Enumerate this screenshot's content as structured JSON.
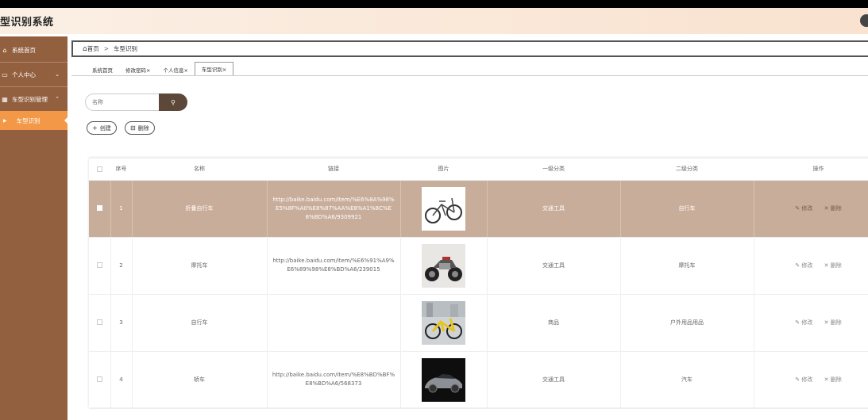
{
  "header": {
    "title": "型识别系统"
  },
  "sidebar": {
    "items": [
      {
        "label": "系统首页",
        "icon": "home-icon"
      },
      {
        "label": "个人中心",
        "icon": "user-card-icon"
      },
      {
        "label": "车型识别管理",
        "icon": "grid-icon"
      }
    ],
    "sub_item": {
      "label": "车型识别"
    }
  },
  "breadcrumb": {
    "home": "首页",
    "sep": ">",
    "current": "车型识别"
  },
  "tabs": [
    {
      "label": "系统首页"
    },
    {
      "label": "修改密码×"
    },
    {
      "label": "个人信息×"
    },
    {
      "label": "车型识别×"
    }
  ],
  "search": {
    "placeholder": "名称"
  },
  "toolbar": {
    "create_label": "创建",
    "delete_label": "删除"
  },
  "table": {
    "headers": [
      "序号",
      "名称",
      "链接",
      "图片",
      "一级分类",
      "二级分类",
      "操作"
    ],
    "edit_label": "修改",
    "delete_label": "删除",
    "rows": [
      {
        "index": "1",
        "name": "折叠自行车",
        "link": "http://baike.baidu.com/item/%E6%8A%98%E5%8F%A0%E8%87%AA%E8%A1%8C%E8%BD%A6/9309921",
        "cat1": "交通工具",
        "cat2": "自行车",
        "image": "folding-bike"
      },
      {
        "index": "2",
        "name": "摩托车",
        "link": "http://baike.baidu.com/item/%E6%91%A9%E6%89%98%E8%BD%A6/239015",
        "cat1": "交通工具",
        "cat2": "摩托车",
        "image": "motorcycle"
      },
      {
        "index": "3",
        "name": "自行车",
        "link": "",
        "cat1": "商品",
        "cat2": "户外用品用品",
        "image": "yellow-bike"
      },
      {
        "index": "4",
        "name": "轿车",
        "link": "http://baike.baidu.com/item/%E8%BD%BF%E8%BD%A6/568373",
        "cat1": "交通工具",
        "cat2": "汽车",
        "image": "sports-car"
      }
    ]
  },
  "colors": {
    "sidebar": "#93603f",
    "accent": "#f39846",
    "selected_row": "#c9ad9b",
    "search_button": "#5c4738"
  }
}
